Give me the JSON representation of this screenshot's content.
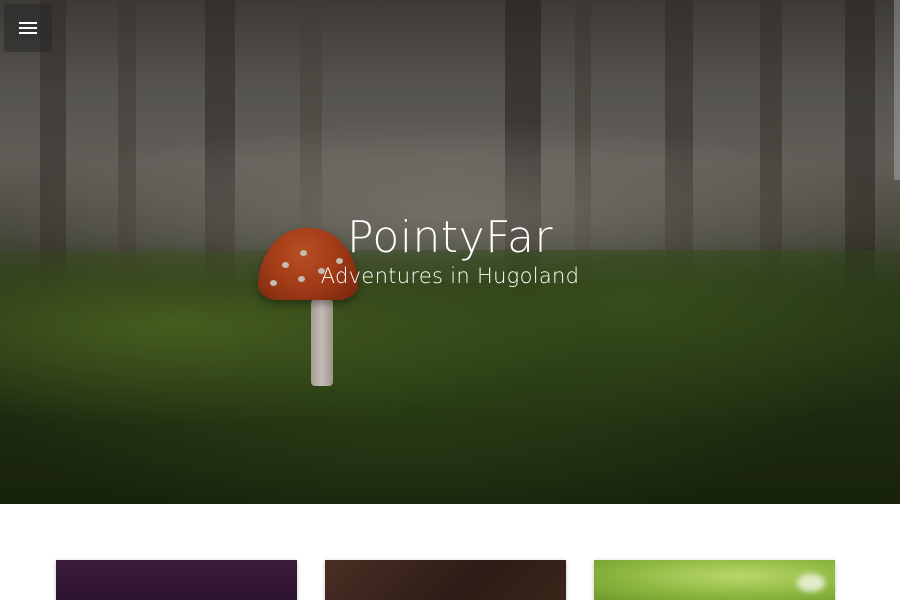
{
  "site": {
    "title": "PointyFar",
    "subtitle": "Adventures in Hugoland"
  },
  "menu": {
    "icon": "hamburger-menu-icon"
  },
  "posts": [
    {
      "thumbnail": "purple-texture"
    },
    {
      "thumbnail": "brown-wood-texture"
    },
    {
      "thumbnail": "green-dandelion"
    }
  ],
  "colors": {
    "title_text": "#ffffff",
    "page_background": "#ffffff"
  }
}
